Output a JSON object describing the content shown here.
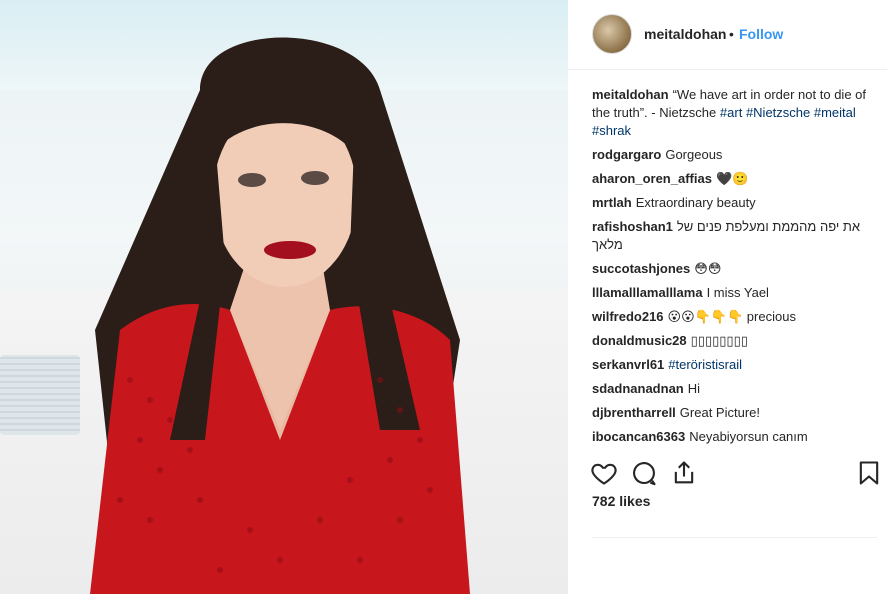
{
  "post": {
    "username": "meitaldohan",
    "dot": "•",
    "follow_label": "Follow"
  },
  "caption": {
    "username": "meitaldohan",
    "text": "“We have art in order not to die of the truth”. - Nietzsche",
    "tags": [
      "#art",
      "#Nietzsche",
      "#meital",
      "#shrak"
    ]
  },
  "comments": [
    {
      "user": "rodgargaro",
      "text": "Gorgeous"
    },
    {
      "user": "aharon_oren_affias",
      "text": "🖤🙂"
    },
    {
      "user": "mrtlah",
      "text": "Extraordinary beauty"
    },
    {
      "user": "rafishoshan1",
      "text": "את יפה מהממת ומעלפת פנים של מלאך"
    },
    {
      "user": "succotashjones",
      "text": "😳😳"
    },
    {
      "user": "lllamalllamalllama",
      "text": "I miss Yael"
    },
    {
      "user": "wilfredo216",
      "text": "😮😮👇👇👇 precious"
    },
    {
      "user": "donaldmusic28",
      "text": "▯▯▯▯▯▯▯▯"
    },
    {
      "user": "serkanvrl61",
      "text": "#teröristisrail",
      "is_tag": true
    },
    {
      "user": "sdadnanadnan",
      "text": "Hi"
    },
    {
      "user": "djbrentharrell",
      "text": "Great Picture!"
    },
    {
      "user": "ibocancan6363",
      "text": "Neyabiyorsun canım"
    }
  ],
  "likes": "782 likes",
  "icons": [
    "heart-icon",
    "comment-icon",
    "share-icon",
    "bookmark-icon"
  ],
  "colors": {
    "link": "#3897f0",
    "tag": "#003569",
    "dress": "#c8161d"
  }
}
